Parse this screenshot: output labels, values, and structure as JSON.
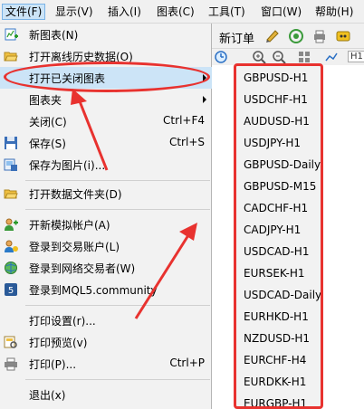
{
  "menubar": {
    "items": [
      {
        "label": "文件(F)",
        "active": true
      },
      {
        "label": "显示(V)"
      },
      {
        "label": "插入(I)"
      },
      {
        "label": "图表(C)"
      },
      {
        "label": "工具(T)"
      },
      {
        "label": "窗口(W)"
      },
      {
        "label": "帮助(H)"
      }
    ]
  },
  "toolbar": {
    "new_order": "新订单",
    "timeframe_tab": "H1"
  },
  "file_menu": {
    "items": [
      {
        "label": "新图表(N)",
        "shortcut": "",
        "icon": "new-chart-icon"
      },
      {
        "label": "打开离线历史数据(O)",
        "shortcut": "",
        "icon": "open-folder-icon"
      },
      {
        "label": "打开已关闭图表",
        "shortcut": "",
        "icon": "",
        "submenu": true
      },
      {
        "label": "图表夹",
        "shortcut": "",
        "icon": "",
        "submenu": true
      },
      {
        "label": "关闭(C)",
        "shortcut": "Ctrl+F4",
        "icon": ""
      },
      {
        "label": "保存(S)",
        "shortcut": "Ctrl+S",
        "icon": "floppy-disk-icon"
      },
      {
        "label": "保存为图片(i)...",
        "shortcut": "",
        "icon": "save-picture-icon"
      },
      {
        "label": "打开数据文件夹(D)",
        "shortcut": "",
        "icon": "folder-icon"
      },
      {
        "label": "开新模拟帐户(A)",
        "shortcut": "",
        "icon": "add-user-icon"
      },
      {
        "label": "登录到交易账户(L)",
        "shortcut": "",
        "icon": "login-user-icon"
      },
      {
        "label": "登录到网络交易者(W)",
        "shortcut": "",
        "icon": "globe-icon"
      },
      {
        "label": "登录到MQL5.community",
        "shortcut": "",
        "icon": "mql5-icon"
      },
      {
        "label": "打印设置(r)...",
        "shortcut": "",
        "icon": ""
      },
      {
        "label": "打印预览(v)",
        "shortcut": "",
        "icon": "print-preview-icon"
      },
      {
        "label": "打印(P)...",
        "shortcut": "Ctrl+P",
        "icon": "printer-icon"
      },
      {
        "label": "退出(x)",
        "shortcut": "",
        "icon": ""
      }
    ]
  },
  "closed_charts_submenu": {
    "items": [
      "GBPUSD-H1",
      "USDCHF-H1",
      "AUDUSD-H1",
      "USDJPY-H1",
      "GBPUSD-Daily",
      "GBPUSD-M15",
      "CADCHF-H1",
      "CADJPY-H1",
      "USDCAD-H1",
      "EURSEK-H1",
      "USDCAD-Daily",
      "EURHKD-H1",
      "NZDUSD-H1",
      "EURCHF-H4",
      "EURDKK-H1",
      "EURGBP-H1"
    ]
  },
  "colors": {
    "annotation_red": "#e8322f",
    "highlight_blue": "#cce4f7",
    "menu_bg": "#f2f2f2"
  }
}
